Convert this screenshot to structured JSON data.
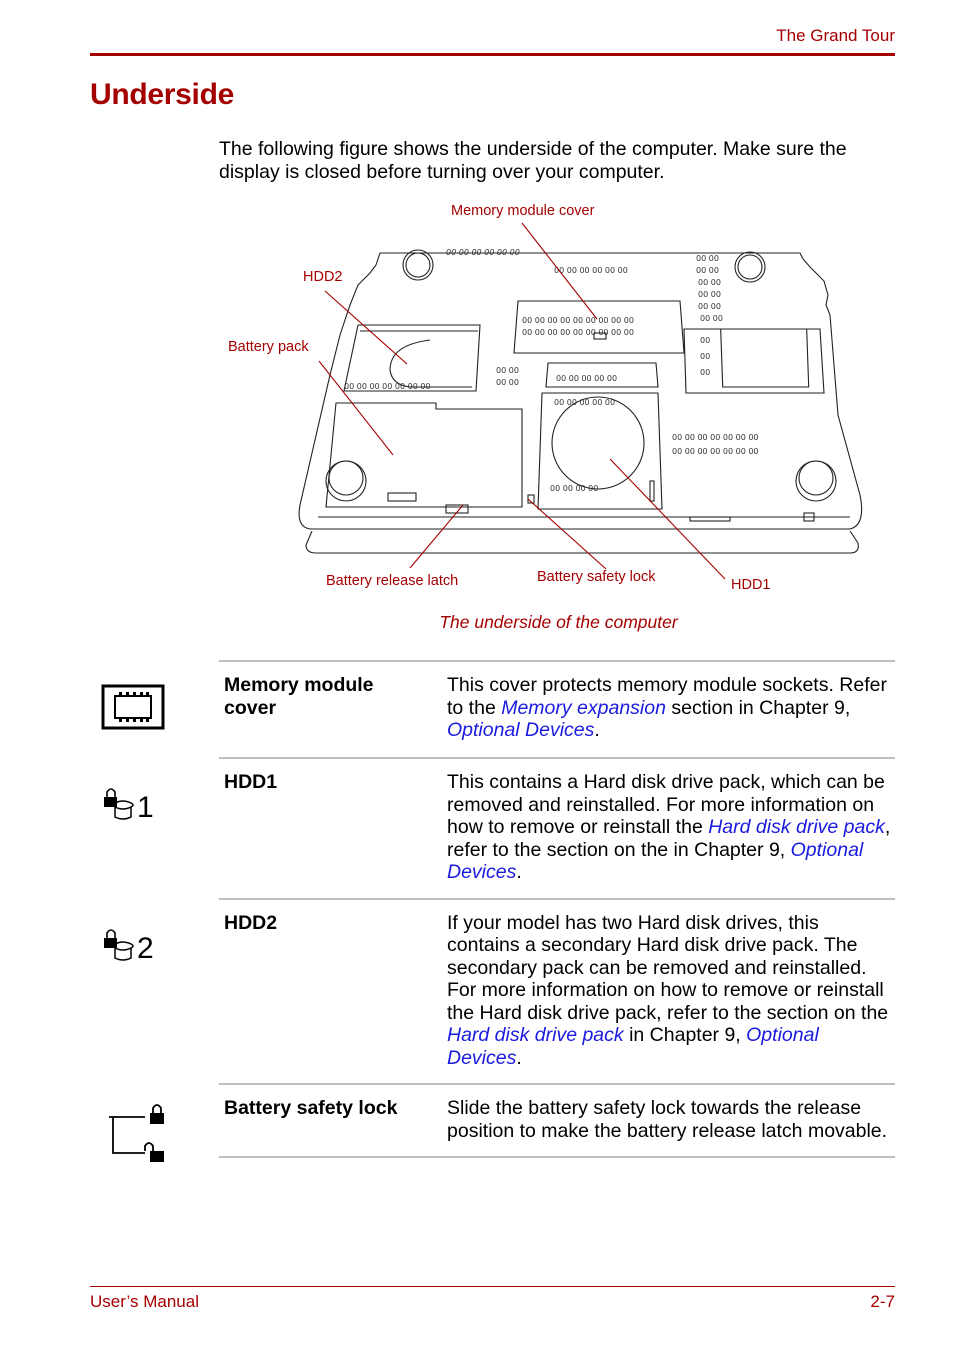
{
  "header": {
    "section_title": "The Grand Tour"
  },
  "page": {
    "title": "Underside",
    "intro": "The following figure shows the underside of the computer. Make sure the display is closed before turning over your computer."
  },
  "figure": {
    "callouts": {
      "memory_module_cover": "Memory module cover",
      "hdd2": "HDD2",
      "battery_pack": "Battery pack",
      "battery_release_latch": "Battery release latch",
      "battery_safety_lock": "Battery safety lock",
      "hdd1": "HDD1"
    },
    "caption": "The underside of the computer"
  },
  "table": {
    "rows": [
      {
        "icon": "memory-module-icon",
        "term": "Memory module cover",
        "parts": [
          {
            "text": "This cover protects memory module sockets. Refer to the "
          },
          {
            "text": "Memory expansion",
            "link": true
          },
          {
            "text": " section in Chapter 9, "
          },
          {
            "text": "Optional Devices",
            "link": true
          },
          {
            "text": "."
          }
        ]
      },
      {
        "icon": "hdd1-lock-icon",
        "icon_number": "1",
        "term": "HDD1",
        "parts": [
          {
            "text": "This contains a Hard disk drive pack, which can be removed and reinstalled. For more information on how to remove or reinstall the "
          },
          {
            "text": "Hard disk drive pack",
            "link": true
          },
          {
            "text": ", refer to the section on the in Chapter 9, "
          },
          {
            "text": "Optional Devices",
            "link": true
          },
          {
            "text": "."
          }
        ]
      },
      {
        "icon": "hdd2-lock-icon",
        "icon_number": "2",
        "term": "HDD2",
        "parts": [
          {
            "text": "If your model has two Hard disk drives, this contains a secondary Hard disk drive pack. The secondary pack can be removed and reinstalled. For more information on how to remove or reinstall the Hard disk drive pack, refer to the section on the "
          },
          {
            "text": "Hard disk drive pack",
            "link": true
          },
          {
            "text": " in Chapter 9, "
          },
          {
            "text": "Optional Devices",
            "link": true
          },
          {
            "text": "."
          }
        ]
      },
      {
        "icon": "battery-safety-lock-icon",
        "term": "Battery safety lock",
        "parts": [
          {
            "text": "Slide the battery safety lock towards the release position to make the battery release latch movable."
          }
        ]
      }
    ]
  },
  "footer": {
    "manual_name": "User’s Manual",
    "page_number": "2-7"
  },
  "colors": {
    "accent": "#a50000",
    "link": "#1a1ae0",
    "rule": "#c0c0c0"
  }
}
